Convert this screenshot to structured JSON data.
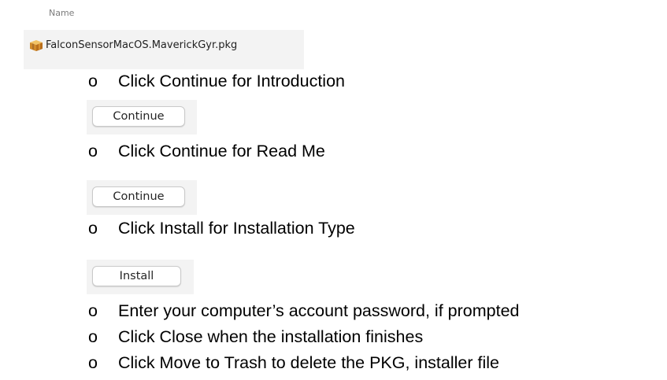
{
  "finder": {
    "column_header": "Name",
    "file_name": "FalconSensorMacOS.MaverickGyr.pkg",
    "file_icon": "package-icon"
  },
  "bullet_glyph": "o",
  "steps": [
    {
      "text": "Click Continue for Introduction"
    },
    {
      "text": "Click Continue for Read Me"
    },
    {
      "text": "Click Install for Installation Type"
    },
    {
      "text": "Enter your computer’s account password, if prompted"
    },
    {
      "text": "Click Close when the installation finishes"
    },
    {
      "text": "Click Move to Trash to delete the PKG, installer file"
    }
  ],
  "buttons": {
    "continue_intro": "Continue",
    "continue_readme": "Continue",
    "install": "Install"
  },
  "colors": {
    "button_border": "#c9c9c9",
    "panel_background": "#f3f3f3",
    "header_text": "#7c7c7c"
  }
}
